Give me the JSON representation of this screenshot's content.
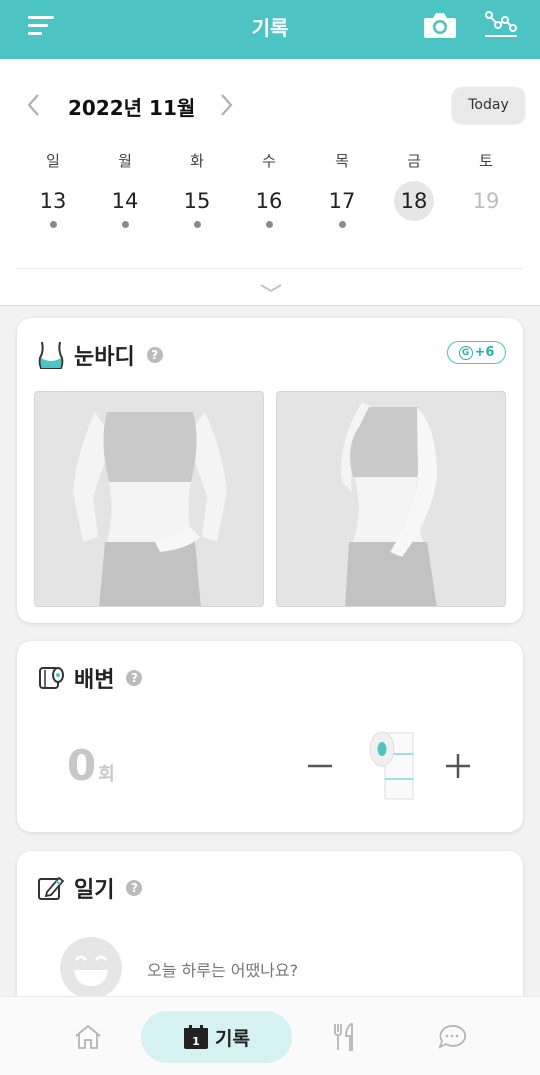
{
  "header": {
    "title": "기록",
    "menu_icon": "menu-icon",
    "camera_icon": "camera-icon",
    "graph_icon": "graph-icon",
    "color": "#4cc4c4"
  },
  "calendar": {
    "month_label": "2022년 11월",
    "today_label": "Today",
    "days": [
      {
        "weekday": "일",
        "date": "13",
        "has_record": true
      },
      {
        "weekday": "월",
        "date": "14",
        "has_record": true
      },
      {
        "weekday": "화",
        "date": "15",
        "has_record": true
      },
      {
        "weekday": "수",
        "date": "16",
        "has_record": true
      },
      {
        "weekday": "목",
        "date": "17",
        "has_record": true
      },
      {
        "weekday": "금",
        "date": "18",
        "has_record": false,
        "selected": true
      },
      {
        "weekday": "토",
        "date": "19",
        "has_record": false,
        "future": true
      }
    ]
  },
  "body_card": {
    "title": "눈바디",
    "help": "?",
    "badge_g": "G",
    "badge_value": "+6",
    "photos": [
      "front-body-photo",
      "side-body-photo"
    ]
  },
  "poop_card": {
    "title": "배변",
    "help": "?",
    "count": "0",
    "unit": "회"
  },
  "diary_card": {
    "title": "일기",
    "help": "?",
    "placeholder": "오늘 하루는 어땠나요?"
  },
  "nav": {
    "home_icon": "home-icon",
    "record_label": "기록",
    "record_day": "1",
    "food_icon": "fork-knife-icon",
    "chat_icon": "chat-icon"
  }
}
